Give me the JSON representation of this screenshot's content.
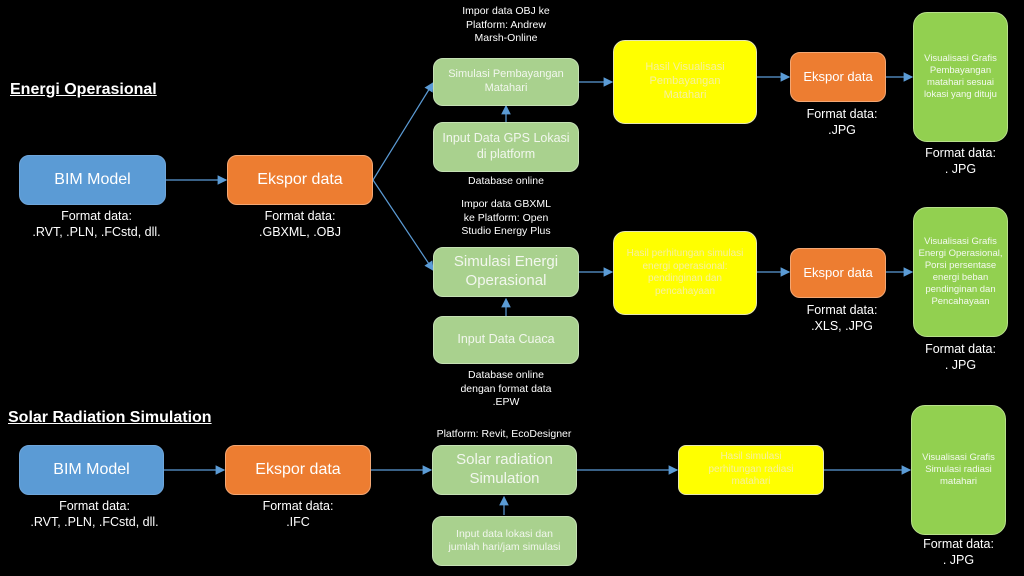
{
  "sections": {
    "energy_title": "Energi Operasional",
    "solar_title": "Solar Radiation Simulation"
  },
  "energy": {
    "bim": {
      "label": "BIM Model",
      "format_label": "Format data:",
      "format_value": ".RVT, .PLN, .FCstd, dll."
    },
    "export": {
      "label": "Ekspor data",
      "format_label": "Format data:",
      "format_value": ".GBXML, .OBJ"
    },
    "shading": {
      "platform_note": [
        "Impor data OBJ ke",
        "Platform: Andrew",
        "Marsh-Online"
      ],
      "sim_label": "Simulasi Pembayangan Matahari",
      "gps_input": "Input Data GPS Lokasi di platform",
      "gps_note": "Database online",
      "result": "Hasil Visualisasi Pembayangan Matahari",
      "export_label": "Ekspor data",
      "export_format_label": "Format data:",
      "export_format_value": ".JPG",
      "viz": "Visualisasi Grafis Pembayangan matahari sesuai lokasi yang dituju",
      "viz_format_label": "Format data:",
      "viz_format_value": ". JPG"
    },
    "operational": {
      "platform_note": [
        "Impor data GBXML",
        "ke Platform: Open",
        "Studio Energy Plus"
      ],
      "sim_label": "Simulasi Energi Operasional",
      "weather_input": "Input Data Cuaca",
      "weather_note": [
        "Database online",
        "dengan format data",
        ".EPW"
      ],
      "result": "Hasil perhitungan simulasi energi operasional: pendinginan dan pencahayaan",
      "export_label": "Ekspor data",
      "export_format_label": "Format data:",
      "export_format_value": ".XLS, .JPG",
      "viz": "Visualisasi Grafis Energi Operasional, Porsi persentase energi beban pendinginan dan Pencahayaan",
      "viz_format_label": "Format data:",
      "viz_format_value": ". JPG"
    }
  },
  "solar": {
    "bim": {
      "label": "BIM Model",
      "format_label": "Format data:",
      "format_value": ".RVT, .PLN, .FCstd, dll."
    },
    "export": {
      "label": "Ekspor data",
      "format_label": "Format data:",
      "format_value": ".IFC"
    },
    "platform_note": "Platform: Revit, EcoDesigner",
    "sim_label": "Solar radiation Simulation",
    "location_input": "Input data lokasi dan jumlah hari/jam simulasi",
    "result": "Hasil simulasi perhitungan radiasi matahari",
    "viz": "Visualisasi Grafis Simulasi radiasi matahari",
    "viz_format_label": "Format data:",
    "viz_format_value": ". JPG"
  },
  "colors": {
    "background": "#000000",
    "bim_blue": "#5b9bd5",
    "export_orange": "#ed7d31",
    "process_green": "#a9d18e",
    "viz_green": "#92d050",
    "result_yellow": "#ffff00",
    "arrow": "#5b9bd5"
  }
}
